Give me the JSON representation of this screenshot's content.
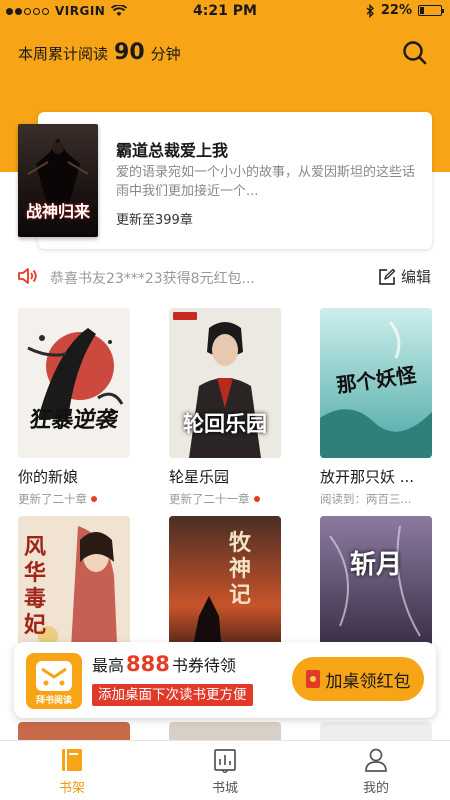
{
  "status_bar": {
    "carrier": "VIRGIN",
    "time": "4:21 PM",
    "battery_text": "22%",
    "battery_level": 0.22
  },
  "header": {
    "reading_prefix": "本周累计阅读",
    "reading_minutes": "90",
    "reading_unit": "分钟",
    "search_icon": "search-icon"
  },
  "featured": {
    "cover_title": "战神归来",
    "title": "霸道总裁爱上我",
    "description": "爱的语录宛如一个小小的故事，从爱因斯坦的这些话雨中我们更加接近一个...",
    "update": "更新至399章"
  },
  "notice": {
    "text": "恭喜书友23***23获得8元红包...",
    "edit_label": "编辑",
    "speaker_icon": "speaker-icon",
    "edit_icon": "edit-icon"
  },
  "books": [
    {
      "title": "你的新娘",
      "status": "更新了二十章",
      "new": true,
      "cover_text": "狂暴逆袭"
    },
    {
      "title": "轮星乐园",
      "status": "更新了二十一章",
      "new": true,
      "cover_text": "轮回乐园"
    },
    {
      "title": "放开那只妖 ...",
      "status": "阅读到：两百三...",
      "new": false,
      "cover_text": "那个妖怪"
    },
    {
      "title": "",
      "status": "",
      "new": false,
      "cover_text": "风华毒妃"
    },
    {
      "title": "",
      "status": "",
      "new": false,
      "cover_text": "牧神记"
    },
    {
      "title": "",
      "status": "",
      "new": false,
      "cover_text": "斩月"
    }
  ],
  "promo": {
    "prefix": "最高",
    "amount": "888",
    "suffix": "书券待领",
    "strip": "添加桌面下次读书更方便",
    "button": "加桌领红包",
    "logo_label": "拜书阅读"
  },
  "tabs": [
    {
      "label": "书架",
      "icon": "bookshelf-icon",
      "active": true
    },
    {
      "label": "书城",
      "icon": "bookstore-icon",
      "active": false
    },
    {
      "label": "我的",
      "icon": "profile-icon",
      "active": false
    }
  ],
  "colors": {
    "accent": "#f7a416",
    "red": "#e63b24"
  }
}
